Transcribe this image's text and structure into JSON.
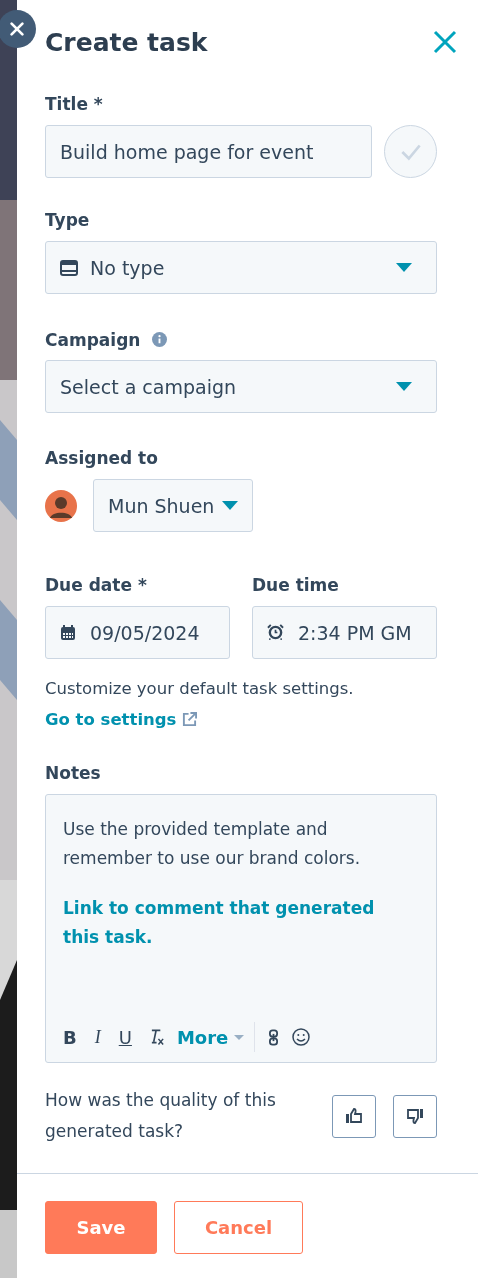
{
  "panel": {
    "title": "Create task"
  },
  "title_field": {
    "label": "Title *",
    "value": "Build home page for event",
    "completed": false
  },
  "type_field": {
    "label": "Type",
    "value": "No type"
  },
  "campaign_field": {
    "label": "Campaign",
    "placeholder": "Select a campaign"
  },
  "assigned": {
    "label": "Assigned to",
    "value": "Mun Shuen"
  },
  "due_date": {
    "label": "Due date *",
    "value": "09/05/2024"
  },
  "due_time": {
    "label": "Due time",
    "value": "2:34 PM GM"
  },
  "helper": {
    "text": "Customize your default task settings.",
    "link": "Go to settings"
  },
  "notes": {
    "label": "Notes",
    "paragraphs": [
      {
        "kind": "text",
        "text": "Use the provided template and remember to use our brand colors."
      },
      {
        "kind": "link",
        "text": "Link to comment that generated this task."
      }
    ],
    "toolbar": [
      {
        "kind": "bold",
        "text": "B"
      },
      {
        "kind": "italic",
        "text": "I"
      },
      {
        "kind": "underline",
        "text": "U"
      },
      {
        "kind": "clear"
      },
      {
        "kind": "more",
        "text": "More"
      },
      {
        "kind": "divider"
      },
      {
        "kind": "link"
      },
      {
        "kind": "emoji"
      }
    ]
  },
  "feedback": {
    "question": "How was the quality of this generated task?"
  },
  "buttons": [
    {
      "kind": "primary",
      "label": "Save"
    },
    {
      "kind": "secondary",
      "label": "Cancel"
    }
  ]
}
